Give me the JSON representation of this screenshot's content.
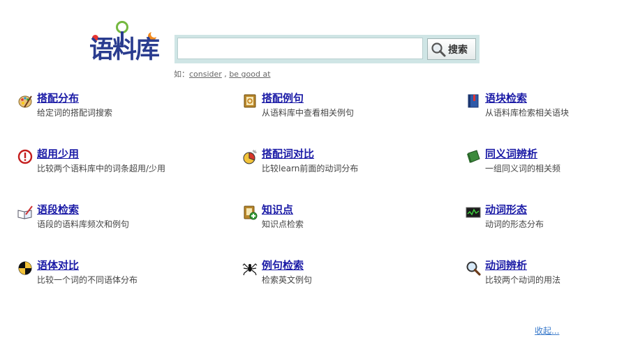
{
  "logo": {
    "text": "语料库"
  },
  "search": {
    "value": "",
    "placeholder": "",
    "button_label": "搜索"
  },
  "examples": {
    "prefix": "如：",
    "ex1": "consider",
    "sep": " , ",
    "ex2": "be good at"
  },
  "items": [
    {
      "title": "搭配分布",
      "desc": "给定词的搭配词搜索"
    },
    {
      "title": "搭配例句",
      "desc": "从语料库中查看相关例句"
    },
    {
      "title": "语块检索",
      "desc": "从语料库检索相关语块"
    },
    {
      "title": "超用少用",
      "desc": "比较两个语料库中的词条超用/少用"
    },
    {
      "title": "搭配词对比",
      "desc": "比较learn前面的动词分布"
    },
    {
      "title": "同义词辨析",
      "desc": "一组同义词的相关频"
    },
    {
      "title": "语段检索",
      "desc": "语段的语料库频次和例句"
    },
    {
      "title": "知识点",
      "desc": "知识点检索"
    },
    {
      "title": "动词形态",
      "desc": "动词的形态分布"
    },
    {
      "title": "语体对比",
      "desc": "比较一个词的不同语体分布"
    },
    {
      "title": "例句检索",
      "desc": "检索英文例句"
    },
    {
      "title": "动词辨析",
      "desc": "比较两个动词的用法"
    }
  ],
  "collapse_label": "收起..."
}
